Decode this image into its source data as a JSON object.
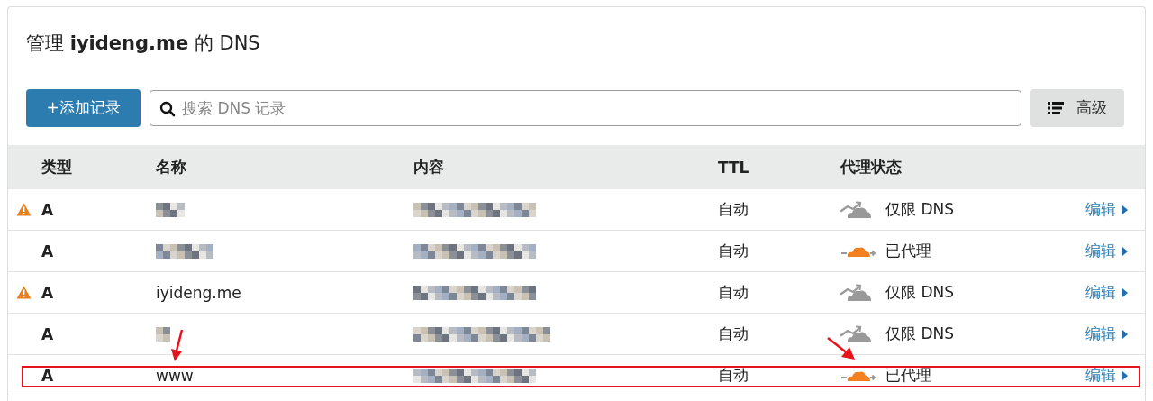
{
  "title": {
    "prefix": "管理 ",
    "domain": "iyideng.me",
    "suffix": " 的 DNS"
  },
  "toolbar": {
    "add_button": "+添加记录",
    "search": {
      "placeholder": "搜索 DNS 记录"
    },
    "advanced_button": "高级"
  },
  "table": {
    "columns": [
      "类型",
      "名称",
      "内容",
      "TTL",
      "代理状态"
    ],
    "rows": [
      {
        "warning": true,
        "type": "A",
        "name_hidden": true,
        "content_hidden": true,
        "ttl": "自动",
        "proxied": false,
        "proxy_status": "仅限 DNS",
        "action": "编辑",
        "highlighted": false
      },
      {
        "warning": false,
        "type": "A",
        "name_hidden": true,
        "content_hidden": true,
        "ttl": "自动",
        "proxied": true,
        "proxy_status": "已代理",
        "action": "编辑",
        "highlighted": false
      },
      {
        "warning": true,
        "type": "A",
        "name": "iyideng.me",
        "content_hidden": true,
        "ttl": "自动",
        "proxied": false,
        "proxy_status": "仅限 DNS",
        "action": "编辑",
        "highlighted": false
      },
      {
        "warning": false,
        "type": "A",
        "name_hidden": true,
        "content_hidden": true,
        "ttl": "自动",
        "proxied": false,
        "proxy_status": "仅限 DNS",
        "action": "编辑",
        "highlighted": false
      },
      {
        "warning": false,
        "type": "A",
        "name": "www",
        "content_hidden": true,
        "ttl": "自动",
        "proxied": true,
        "proxy_status": "已代理",
        "action": "编辑",
        "highlighted": true
      }
    ]
  }
}
